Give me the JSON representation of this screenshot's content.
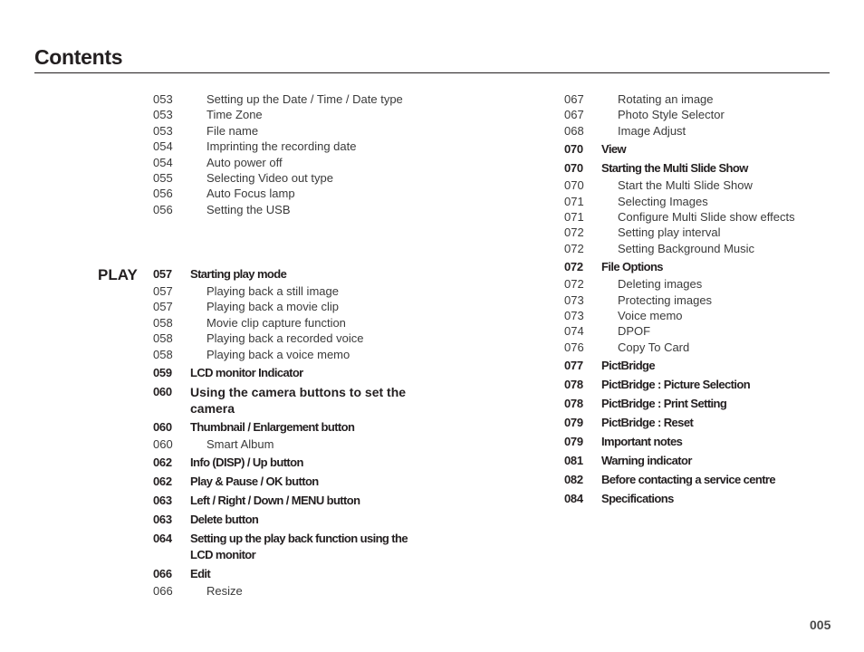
{
  "header": {
    "title": "Contents"
  },
  "left_column": {
    "continued_entries": [
      {
        "page": "053",
        "text": "Setting up the Date / Time / Date type",
        "level": "sub"
      },
      {
        "page": "053",
        "text": "Time Zone",
        "level": "sub"
      },
      {
        "page": "053",
        "text": "File name",
        "level": "sub"
      },
      {
        "page": "054",
        "text": "Imprinting the recording date",
        "level": "sub"
      },
      {
        "page": "054",
        "text": "Auto power off",
        "level": "sub"
      },
      {
        "page": "055",
        "text": "Selecting Video out type",
        "level": "sub"
      },
      {
        "page": "056",
        "text": "Auto Focus lamp",
        "level": "sub"
      },
      {
        "page": "056",
        "text": "Setting the USB",
        "level": "sub"
      }
    ],
    "section_label": "PLAY",
    "play_entries": [
      {
        "page": "057",
        "text": "Starting play mode",
        "level": "main"
      },
      {
        "page": "057",
        "text": "Playing back a still image",
        "level": "sub"
      },
      {
        "page": "057",
        "text": "Playing back a movie clip",
        "level": "sub"
      },
      {
        "page": "058",
        "text": "Movie clip capture function",
        "level": "sub"
      },
      {
        "page": "058",
        "text": "Playing back a recorded voice",
        "level": "sub"
      },
      {
        "page": "058",
        "text": "Playing back a voice memo",
        "level": "sub"
      },
      {
        "page": "059",
        "text": "LCD monitor Indicator",
        "level": "main"
      },
      {
        "page": "060",
        "text": "Using the camera buttons to set the camera",
        "level": "main"
      },
      {
        "page": "060",
        "text": "Thumbnail / Enlargement button",
        "level": "main"
      },
      {
        "page": "060",
        "text": "Smart Album",
        "level": "sub"
      },
      {
        "page": "062",
        "text": "Info (DISP) / Up button",
        "level": "main"
      },
      {
        "page": "062",
        "text": "Play & Pause / OK button",
        "level": "main"
      },
      {
        "page": "063",
        "text": "Left / Right / Down / MENU button",
        "level": "main"
      },
      {
        "page": "063",
        "text": "Delete button",
        "level": "main"
      },
      {
        "page": "064",
        "text": "Setting up the play back function using the LCD monitor",
        "level": "main"
      },
      {
        "page": "066",
        "text": "Edit",
        "level": "main"
      },
      {
        "page": "066",
        "text": "Resize",
        "level": "sub"
      }
    ]
  },
  "right_column": {
    "entries": [
      {
        "page": "067",
        "text": "Rotating an image",
        "level": "sub"
      },
      {
        "page": "067",
        "text": "Photo Style Selector",
        "level": "sub"
      },
      {
        "page": "068",
        "text": "Image Adjust",
        "level": "sub"
      },
      {
        "page": "070",
        "text": "View",
        "level": "main"
      },
      {
        "page": "070",
        "text": "Starting the Multi Slide Show",
        "level": "main"
      },
      {
        "page": "070",
        "text": "Start the Multi Slide Show",
        "level": "sub"
      },
      {
        "page": "071",
        "text": "Selecting Images",
        "level": "sub"
      },
      {
        "page": "071",
        "text": "Configure Multi Slide show effects",
        "level": "sub"
      },
      {
        "page": "072",
        "text": "Setting play interval",
        "level": "sub"
      },
      {
        "page": "072",
        "text": "Setting Background Music",
        "level": "sub"
      },
      {
        "page": "072",
        "text": "File Options",
        "level": "main"
      },
      {
        "page": "072",
        "text": "Deleting images",
        "level": "sub"
      },
      {
        "page": "073",
        "text": "Protecting images",
        "level": "sub"
      },
      {
        "page": "073",
        "text": "Voice memo",
        "level": "sub"
      },
      {
        "page": "074",
        "text": "DPOF",
        "level": "sub"
      },
      {
        "page": "076",
        "text": "Copy To Card",
        "level": "sub"
      },
      {
        "page": "077",
        "text": "PictBridge",
        "level": "main"
      },
      {
        "page": "078",
        "text": "PictBridge : Picture Selection",
        "level": "main"
      },
      {
        "page": "078",
        "text": "PictBridge : Print Setting",
        "level": "main"
      },
      {
        "page": "079",
        "text": "PictBridge : Reset",
        "level": "main"
      },
      {
        "page": "079",
        "text": "Important notes",
        "level": "main"
      },
      {
        "page": "081",
        "text": "Warning indicator",
        "level": "main"
      },
      {
        "page": "082",
        "text": "Before contacting a service centre",
        "level": "main"
      },
      {
        "page": "084",
        "text": "Specifications",
        "level": "main"
      }
    ]
  },
  "footer": {
    "page_number": "005"
  }
}
